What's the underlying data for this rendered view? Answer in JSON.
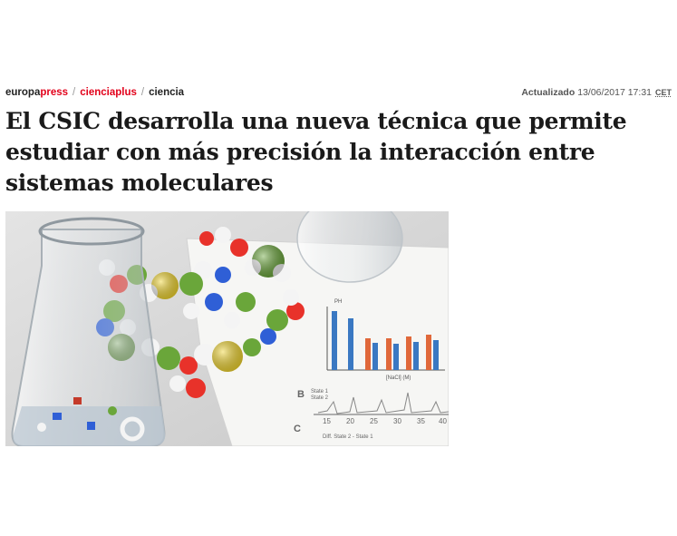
{
  "breadcrumb": {
    "brand_part1": "europa",
    "brand_part2": "press",
    "separator": "/",
    "section": "cienciaplus",
    "subsection": "ciencia"
  },
  "updated": {
    "label": "Actualizado",
    "datetime": "13/06/2017 17:31",
    "timezone": "CET"
  },
  "article": {
    "headline_line1": "El CSIC desarrolla una nueva técnica que permite",
    "headline_line2": "estudiar con más precisión la interacción entre",
    "headline_line3": "sistemas moleculares"
  },
  "image": {
    "chart_label_top": "PH",
    "chart_label_b": "B",
    "chart_label_c": "C",
    "chart_legend_1": "State 1",
    "chart_legend_2": "State 2",
    "chart_xticks": [
      "15",
      "20",
      "25",
      "30",
      "35",
      "40"
    ],
    "chart_footer": "Diff. State 2 - State 1",
    "chart_xaxis": "[NaCl] (M)",
    "colors": {
      "bar_blue": "#3a78c2",
      "bar_orange": "#e0683a",
      "atom_red": "#e8322a",
      "atom_green": "#6aa63a",
      "atom_yellow": "#f2d630",
      "atom_blue": "#2f5fd6",
      "atom_white": "#f4f4f4"
    }
  }
}
